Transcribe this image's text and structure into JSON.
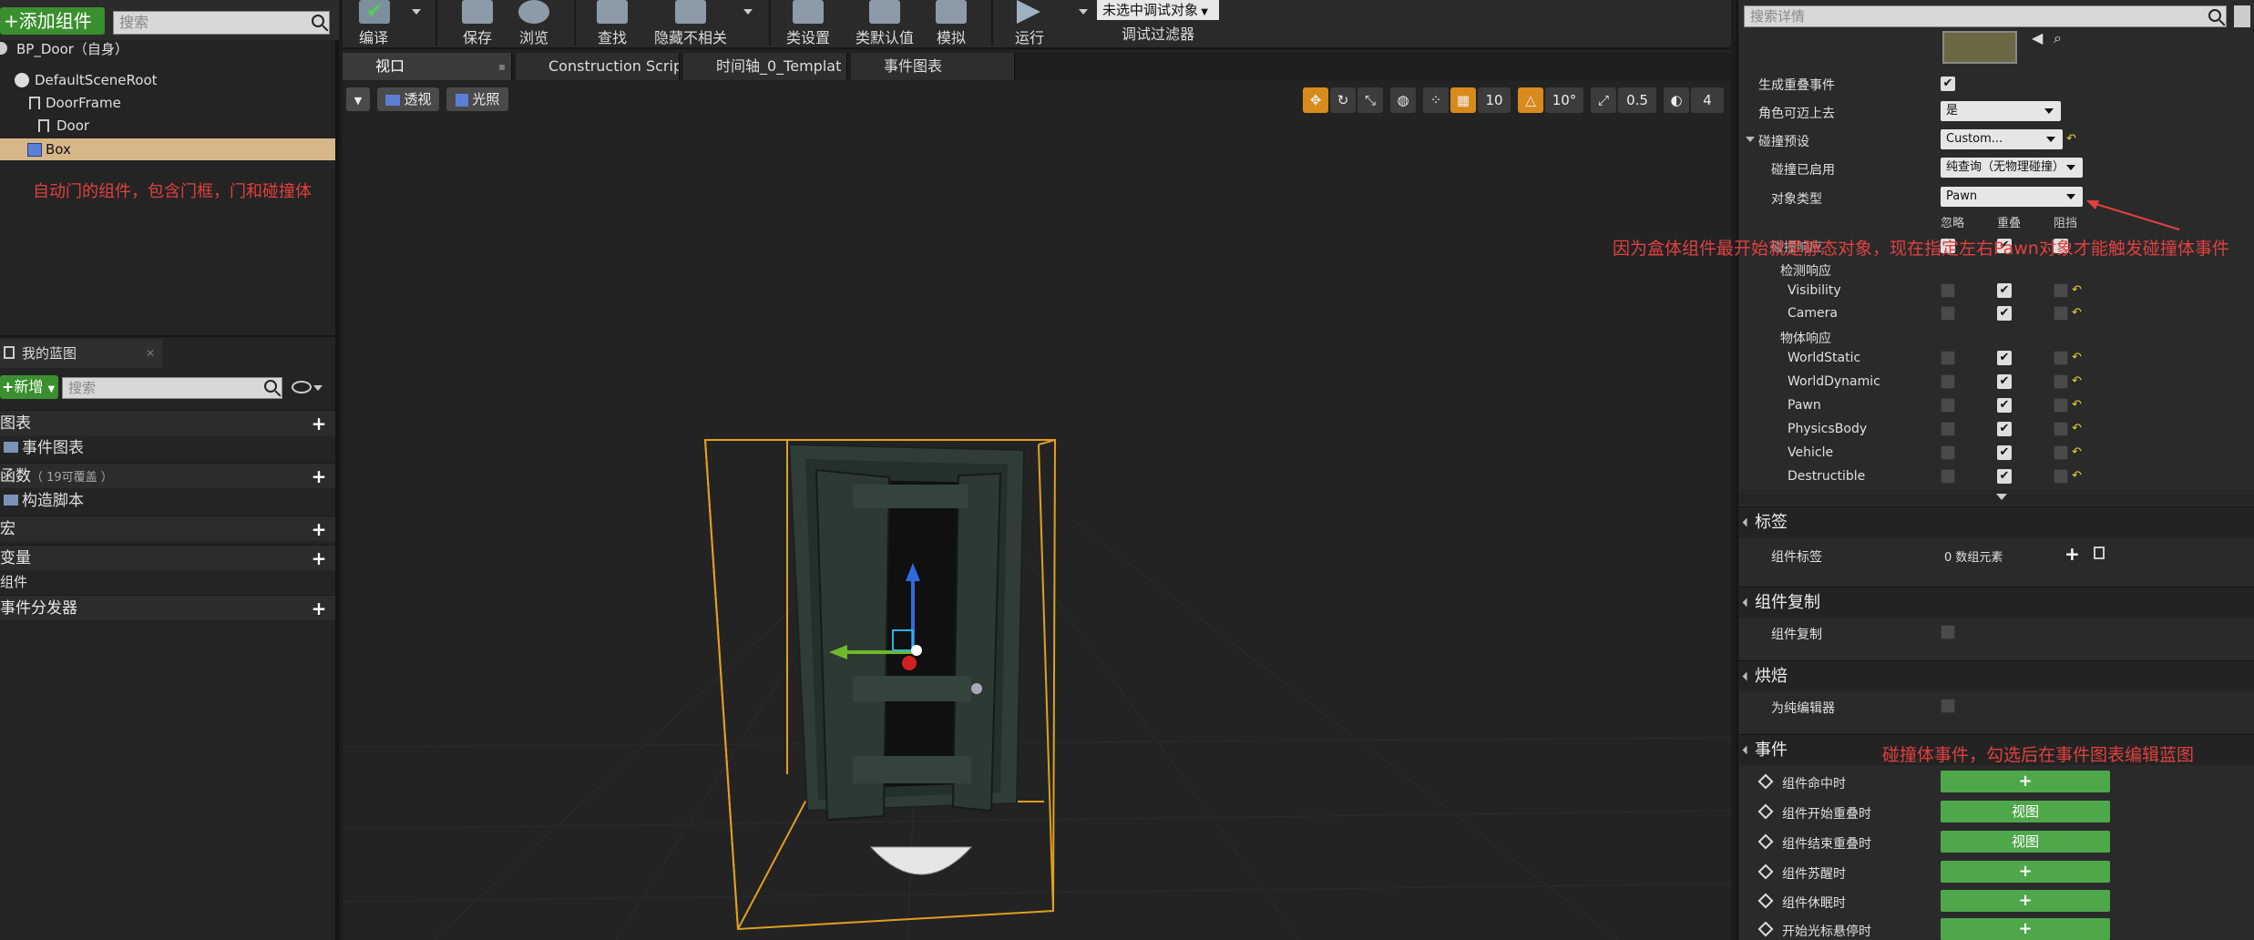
{
  "left": {
    "add_component": "+添加组件",
    "search_placeholder": "搜索",
    "root_label": "BP_Door（自身）",
    "tree": [
      {
        "label": "DefaultSceneRoot"
      },
      {
        "label": "DoorFrame"
      },
      {
        "label": "Door"
      },
      {
        "label": "Box"
      }
    ],
    "annotation": "自动门的组件，包含门框，门和碰撞体",
    "my_blueprint_tab": "我的蓝图",
    "new_button": "新增",
    "bp_search_placeholder": "搜索",
    "categories": {
      "graphs": "图表",
      "event_graph": "事件图表",
      "functions": "函数",
      "functions_note": "（ 19可覆盖 ）",
      "construction_script": "构造脚本",
      "macros": "宏",
      "variables": "变量",
      "components": "组件",
      "event_dispatchers": "事件分发器"
    }
  },
  "toolbar": {
    "compile": "编译",
    "save": "保存",
    "browse": "浏览",
    "find": "查找",
    "hide_unrelated": "隐藏不相关",
    "class_settings": "类设置",
    "class_defaults": "类默认值",
    "simulate": "模拟",
    "play": "运行",
    "debug_object": "未选中调试对象",
    "debug_filter": "调试过滤器"
  },
  "tabs": [
    {
      "label": "视口"
    },
    {
      "label": "Construction Scrip"
    },
    {
      "label": "时间轴_0_Templat"
    },
    {
      "label": "事件图表"
    }
  ],
  "viewport": {
    "perspective": "透视",
    "lighting": "光照",
    "grid_snap": "10",
    "rot_snap": "10°",
    "scale_snap": "0.5",
    "cam_speed": "4"
  },
  "details": {
    "search_placeholder": "搜索详情",
    "generate_overlap": "生成重叠事件",
    "can_step_up": "角色可迈上去",
    "can_step_up_value": "是",
    "collision_presets": "碰撞预设",
    "collision_presets_value": "Custom...",
    "collision_enabled": "碰撞已启用",
    "collision_enabled_value": "纯查询（无物理碰撞）",
    "object_type": "对象类型",
    "object_type_value": "Pawn",
    "col_ignore": "忽略",
    "col_overlap": "重叠",
    "col_block": "阻挡",
    "collision_response_label": "碰撞响应",
    "trace_responses": "检测响应",
    "object_responses": "物体响应",
    "annotation_overlap": "因为盒体组件最开始就是静态对象，现在指定左右Pawn对象才能触发碰撞体事件",
    "trace_rows": [
      {
        "label": "Visibility"
      },
      {
        "label": "Camera"
      }
    ],
    "object_rows": [
      {
        "label": "WorldStatic"
      },
      {
        "label": "WorldDynamic"
      },
      {
        "label": "Pawn"
      },
      {
        "label": "PhysicsBody"
      },
      {
        "label": "Vehicle"
      },
      {
        "label": "Destructible"
      }
    ],
    "tags_section": "标签",
    "component_tags": "组件标签",
    "component_tags_value": "0 数组元素",
    "replication_section": "组件复制",
    "component_replicates": "组件复制",
    "cooking_section": "烘焙",
    "editor_only": "为纯编辑器",
    "events_section": "事件",
    "annotation_events": "碰撞体事件，勾选后在事件图表编辑蓝图",
    "events": [
      {
        "label": "组件命中时",
        "button": "+"
      },
      {
        "label": "组件开始重叠时",
        "button": "视图"
      },
      {
        "label": "组件结束重叠时",
        "button": "视图"
      },
      {
        "label": "组件苏醒时",
        "button": "+"
      },
      {
        "label": "组件休眠时",
        "button": "+"
      },
      {
        "label": "开始光标悬停时",
        "button": "+"
      }
    ]
  },
  "colors": {
    "accent_green": "#4ea84a",
    "selection": "#d7b68a",
    "annotation_red": "#e04040",
    "gizmo_orange": "#e0a020"
  }
}
